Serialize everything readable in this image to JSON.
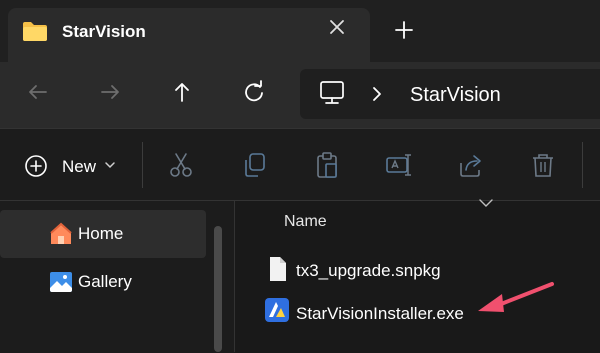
{
  "window": {
    "tab_title": "StarVision",
    "tab_icon": "folder-icon",
    "new_tab_icon": "plus-icon",
    "close_icon": "close-icon"
  },
  "navigation": {
    "back_icon": "arrow-left-icon",
    "forward_icon": "arrow-right-icon",
    "up_icon": "arrow-up-icon",
    "refresh_icon": "refresh-icon",
    "breadcrumb": {
      "root_icon": "monitor-icon",
      "separator": "›",
      "current": "StarVision"
    }
  },
  "command_bar": {
    "new_label": "New",
    "actions": [
      "cut-icon",
      "copy-icon",
      "paste-icon",
      "rename-icon",
      "share-icon",
      "delete-icon"
    ]
  },
  "nav_pane": {
    "items": [
      {
        "label": "Home",
        "icon": "home-icon",
        "selected": true
      },
      {
        "label": "Gallery",
        "icon": "gallery-icon",
        "selected": false
      }
    ]
  },
  "file_list": {
    "column_header": "Name",
    "files": [
      {
        "name": "tx3_upgrade.snpkg",
        "icon": "file-icon"
      },
      {
        "name": "StarVisionInstaller.exe",
        "icon": "installer-icon"
      }
    ]
  },
  "colors": {
    "accent": "#3b82f6",
    "annotation_arrow": "#f0506e",
    "folder": "#f5c048"
  }
}
